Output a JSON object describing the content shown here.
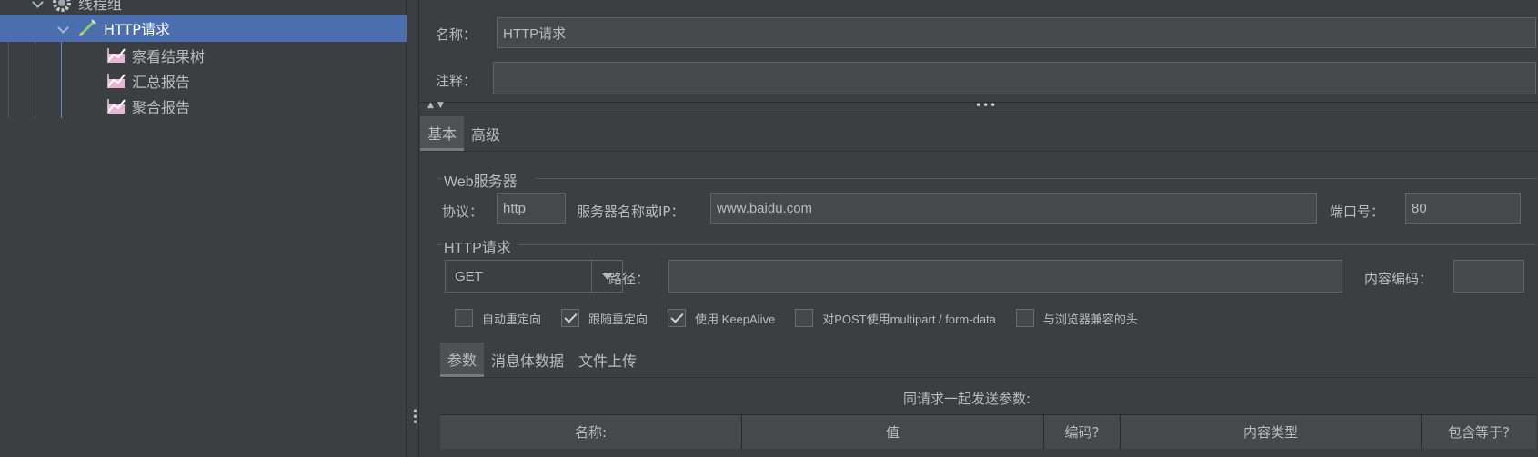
{
  "tree": {
    "thread_group": "线程组",
    "http_request": "HTTP请求",
    "listeners": [
      "察看结果树",
      "汇总报告",
      "聚合报告"
    ]
  },
  "form": {
    "name_label": "名称：",
    "name_value": "HTTP请求",
    "comment_label": "注释：",
    "comment_value": ""
  },
  "config_tabs": [
    "基本",
    "高级"
  ],
  "web_server": {
    "title": "Web服务器",
    "protocol_label": "协议：",
    "protocol_value": "http",
    "server_label": "服务器名称或IP：",
    "server_value": "www.baidu.com",
    "port_label": "端口号：",
    "port_value": "80"
  },
  "http_request": {
    "title": "HTTP请求",
    "method": "GET",
    "path_label": "路径：",
    "path_value": "",
    "encoding_label": "内容编码：",
    "encoding_value": ""
  },
  "options": [
    {
      "label": "自动重定向",
      "checked": false
    },
    {
      "label": "跟随重定向",
      "checked": true
    },
    {
      "label": "使用 KeepAlive",
      "checked": true
    },
    {
      "label": "对POST使用multipart / form-data",
      "checked": false
    },
    {
      "label": "与浏览器兼容的头",
      "checked": false
    }
  ],
  "param_tabs": [
    "参数",
    "消息体数据",
    "文件上传"
  ],
  "params": {
    "caption": "同请求一起发送参数:",
    "columns": [
      "名称:",
      "值",
      "编码?",
      "内容类型",
      "包含等于?"
    ]
  }
}
